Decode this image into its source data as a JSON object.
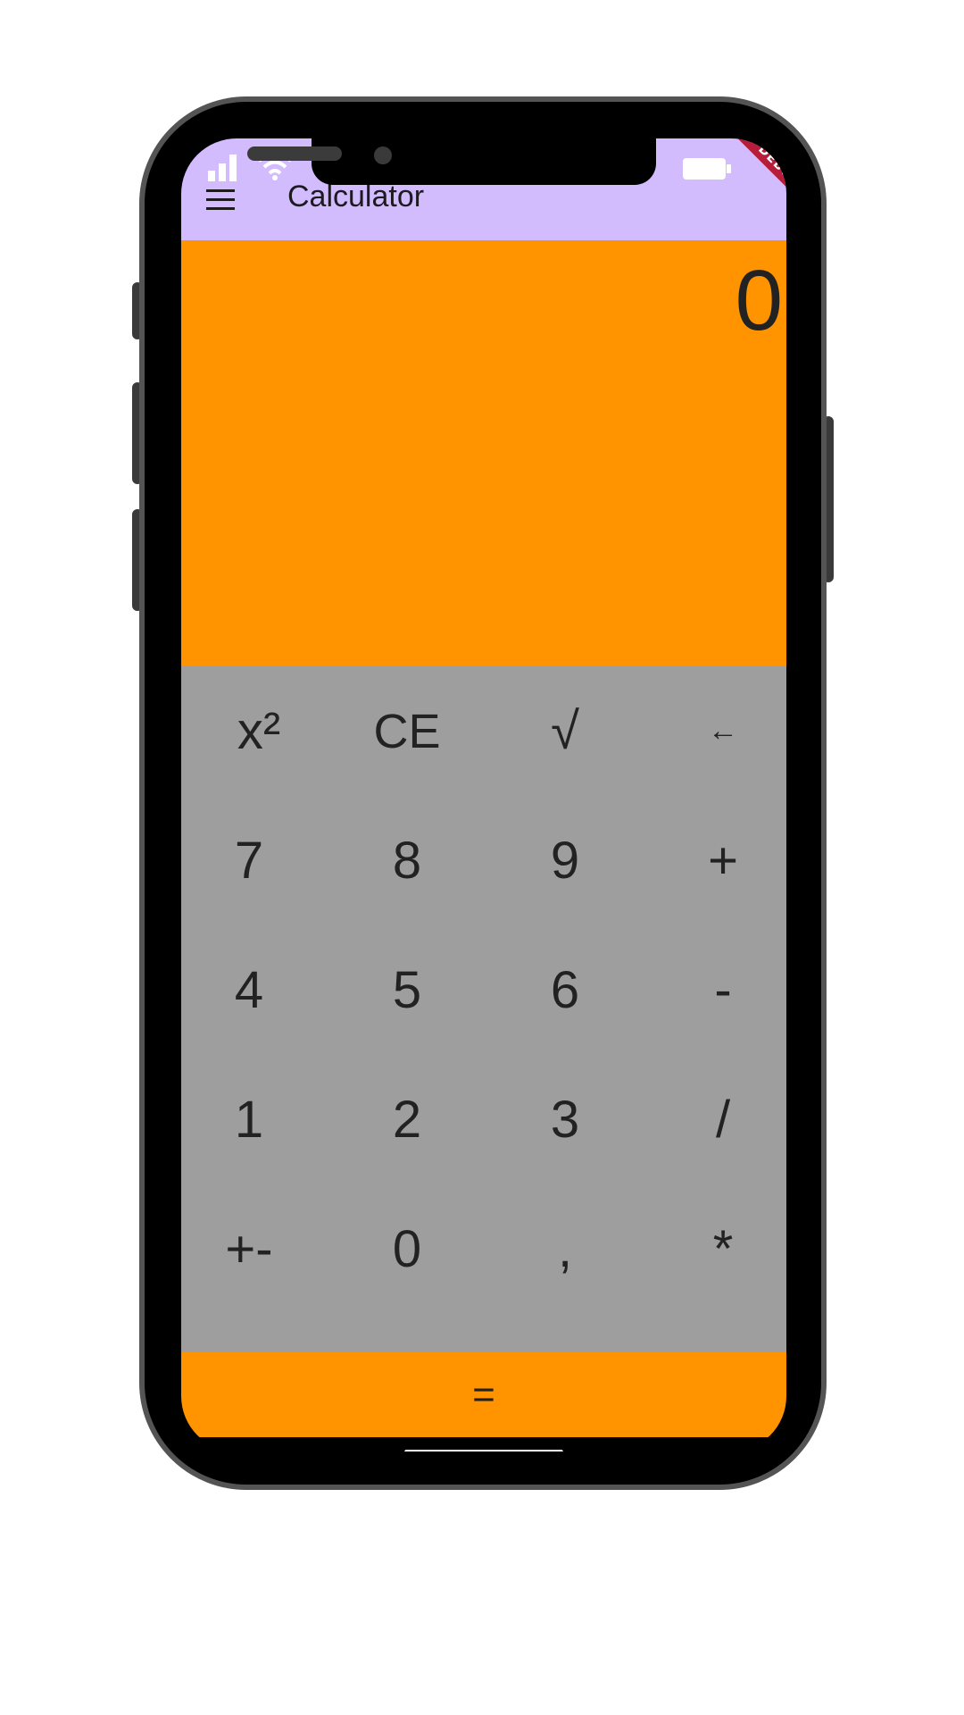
{
  "app": {
    "title": "Calculator"
  },
  "display": {
    "value": "0"
  },
  "debug_banner": {
    "label": "DEBUG"
  },
  "keys": [
    {
      "label": "x²",
      "name": "square"
    },
    {
      "label": "CE",
      "name": "clear-entry"
    },
    {
      "label": "√",
      "name": "square-root"
    },
    {
      "label": "←",
      "name": "backspace"
    },
    {
      "label": "7",
      "name": "digit-7"
    },
    {
      "label": "8",
      "name": "digit-8"
    },
    {
      "label": "9",
      "name": "digit-9"
    },
    {
      "label": "+",
      "name": "plus"
    },
    {
      "label": "4",
      "name": "digit-4"
    },
    {
      "label": "5",
      "name": "digit-5"
    },
    {
      "label": "6",
      "name": "digit-6"
    },
    {
      "label": "-",
      "name": "minus"
    },
    {
      "label": "1",
      "name": "digit-1"
    },
    {
      "label": "2",
      "name": "digit-2"
    },
    {
      "label": "3",
      "name": "digit-3"
    },
    {
      "label": "/",
      "name": "divide"
    },
    {
      "label": "+-",
      "name": "negate"
    },
    {
      "label": "0",
      "name": "digit-0"
    },
    {
      "label": ",",
      "name": "decimal"
    },
    {
      "label": "*",
      "name": "multiply"
    }
  ],
  "equals": {
    "label": "="
  },
  "colors": {
    "appbar": "#d2bcfd",
    "accent": "#ff9300",
    "keypad": "#9e9e9e"
  },
  "icons": {
    "menu": "hamburger-menu-icon",
    "signal": "cellular-signal-icon",
    "wifi": "wifi-icon",
    "battery": "battery-icon"
  }
}
